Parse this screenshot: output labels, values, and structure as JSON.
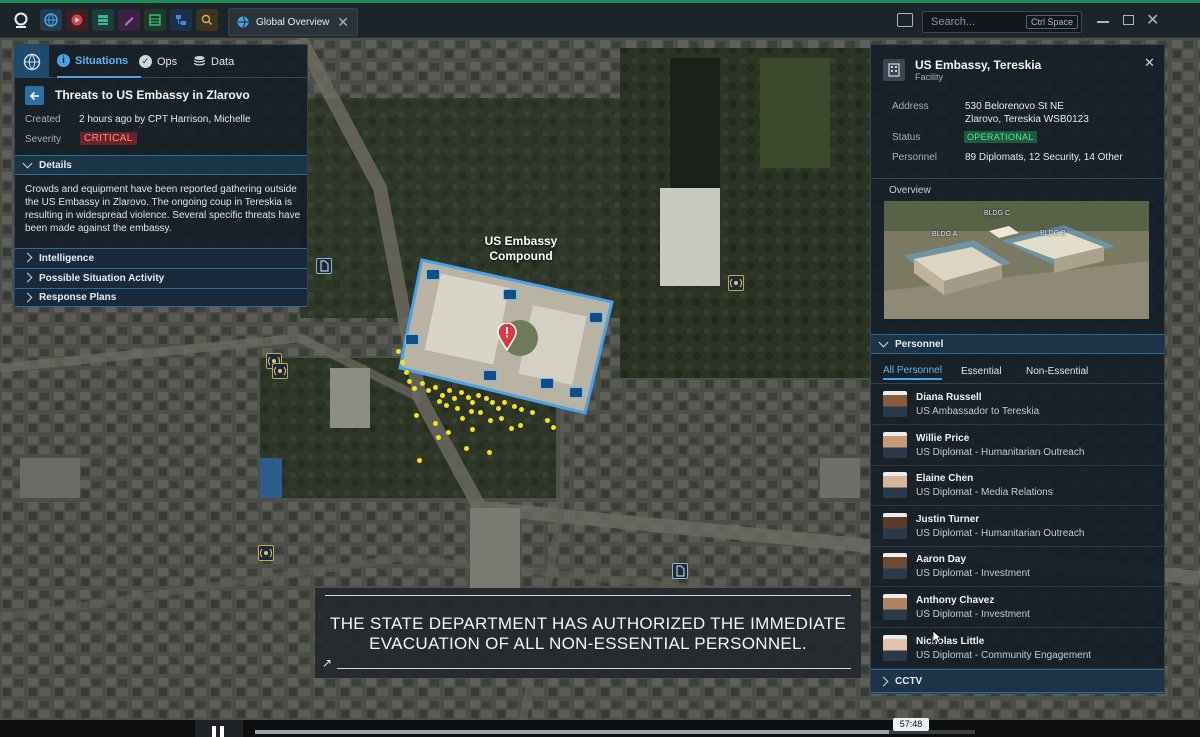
{
  "window": {
    "tab_title": "Global Overview",
    "search_placeholder": "Search...",
    "search_shortcut": "Ctrl Space"
  },
  "left_panel": {
    "tabs": [
      {
        "label": "Situations",
        "active": true
      },
      {
        "label": "Ops",
        "active": false
      },
      {
        "label": "Data",
        "active": false
      }
    ],
    "title": "Threats to US Embassy in Zlarovo",
    "created_label": "Created",
    "created_value": "2 hours ago by CPT Harrison, Michelle",
    "severity_label": "Severity",
    "severity_value": "CRITICAL",
    "details_header": "Details",
    "details_text": "Crowds and equipment have been reported gathering outside the US Embassy in Zlarovo. The ongoing coup in Tereskia is resulting in widespread violence. Several specific threats have been made against the embassy.",
    "sections": [
      "Intelligence",
      "Possible Situation Activity",
      "Response Plans"
    ]
  },
  "map": {
    "compound_label_line1": "US Embassy",
    "compound_label_line2": "Compound",
    "caption_line1": "THE STATE DEPARTMENT HAS AUTHORIZED THE IMMEDIATE",
    "caption_line2": "EVACUATION OF ALL NON-ESSENTIAL PERSONNEL."
  },
  "right_panel": {
    "title": "US Embassy, Tereskia",
    "subtitle": "Facility",
    "address_label": "Address",
    "address_line1": "530 Belorenovo St NE",
    "address_line2": "Zlarovo, Tereskia  WSB0123",
    "status_label": "Status",
    "status_value": "OPERATIONAL",
    "personnel_label": "Personnel",
    "personnel_value": "89 Diplomats, 12 Security, 14 Other",
    "overview_label": "Overview",
    "buildings": [
      "BLDG A",
      "BLDG B",
      "BLDG C"
    ],
    "personnel_header": "Personnel",
    "personnel_tabs": [
      {
        "label": "All Personnel",
        "active": true
      },
      {
        "label": "Essential",
        "active": false
      },
      {
        "label": "Non-Essential",
        "active": false
      }
    ],
    "people": [
      {
        "name": "Diana Russell",
        "role": "US Ambassador to Tereskia",
        "tone": "#8a5a3c"
      },
      {
        "name": "Willie Price",
        "role": "US Diplomat - Humanitarian Outreach",
        "tone": "#c59a74"
      },
      {
        "name": "Elaine Chen",
        "role": "US Diplomat - Media Relations",
        "tone": "#d8b59a"
      },
      {
        "name": "Justin Turner",
        "role": "US Diplomat - Humanitarian Outreach",
        "tone": "#5b3b2a"
      },
      {
        "name": "Aaron Day",
        "role": "US Diplomat - Investment",
        "tone": "#6b4a36"
      },
      {
        "name": "Anthony Chavez",
        "role": "US Diplomat - Investment",
        "tone": "#b08462"
      },
      {
        "name": "Nicholas Little",
        "role": "US Diplomat - Community Engagement",
        "tone": "#e0c3aa"
      }
    ],
    "cctv_header": "CCTV"
  },
  "player": {
    "timestamp": "57:48"
  }
}
